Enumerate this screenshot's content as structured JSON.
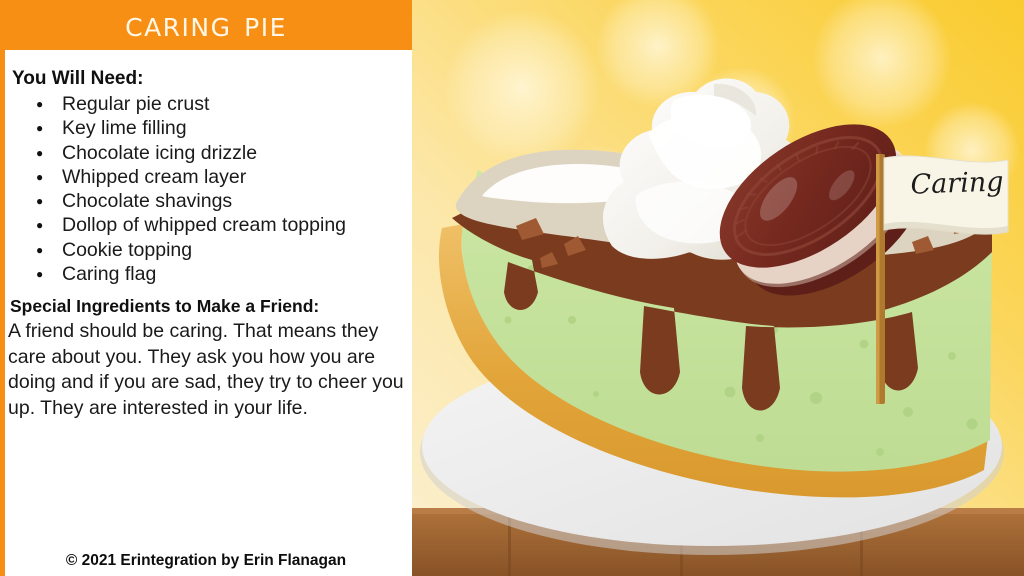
{
  "header": {
    "title": "Caring Pie",
    "bar_color": "#F78F15",
    "title_color": "#FFF7E6"
  },
  "ingredients_section": {
    "heading": "You Will Need:",
    "items": [
      "Regular pie crust",
      "Key lime filling",
      "Chocolate icing drizzle",
      "Whipped cream layer",
      "Chocolate shavings",
      "Dollop of whipped cream topping",
      "Cookie topping",
      "Caring flag"
    ]
  },
  "special_section": {
    "heading": "Special Ingredients to Make a Friend:",
    "body": "A friend should be caring.  That means they care about you.  They ask you how you are doing and if you are sad, they try to cheer you up.  They are interested in your life."
  },
  "footer": {
    "copyright": "© 2021 Erintegration by Erin Flanagan"
  },
  "illustration": {
    "flag_label": "Caring",
    "description": "Slice of key lime pie on a white plate on a wooden table",
    "colors": {
      "background_top": "#FAD240",
      "background_light": "#FDF0CB",
      "filling_green": "#C6E29B",
      "crust_gold": "#E3A63A",
      "drizzle_brown": "#7A3B1E",
      "whipped_cream_layer": "#D8D0BC",
      "whipped_cream_white": "#FFFFFF",
      "cookie_brown": "#6E2B22",
      "cookie_cream": "#F6E7DC",
      "plate_white": "#EFEFEF",
      "table_wood": "#A5673A",
      "flag_cream": "#F7F3E3",
      "flag_pole": "#B07A2E"
    }
  }
}
